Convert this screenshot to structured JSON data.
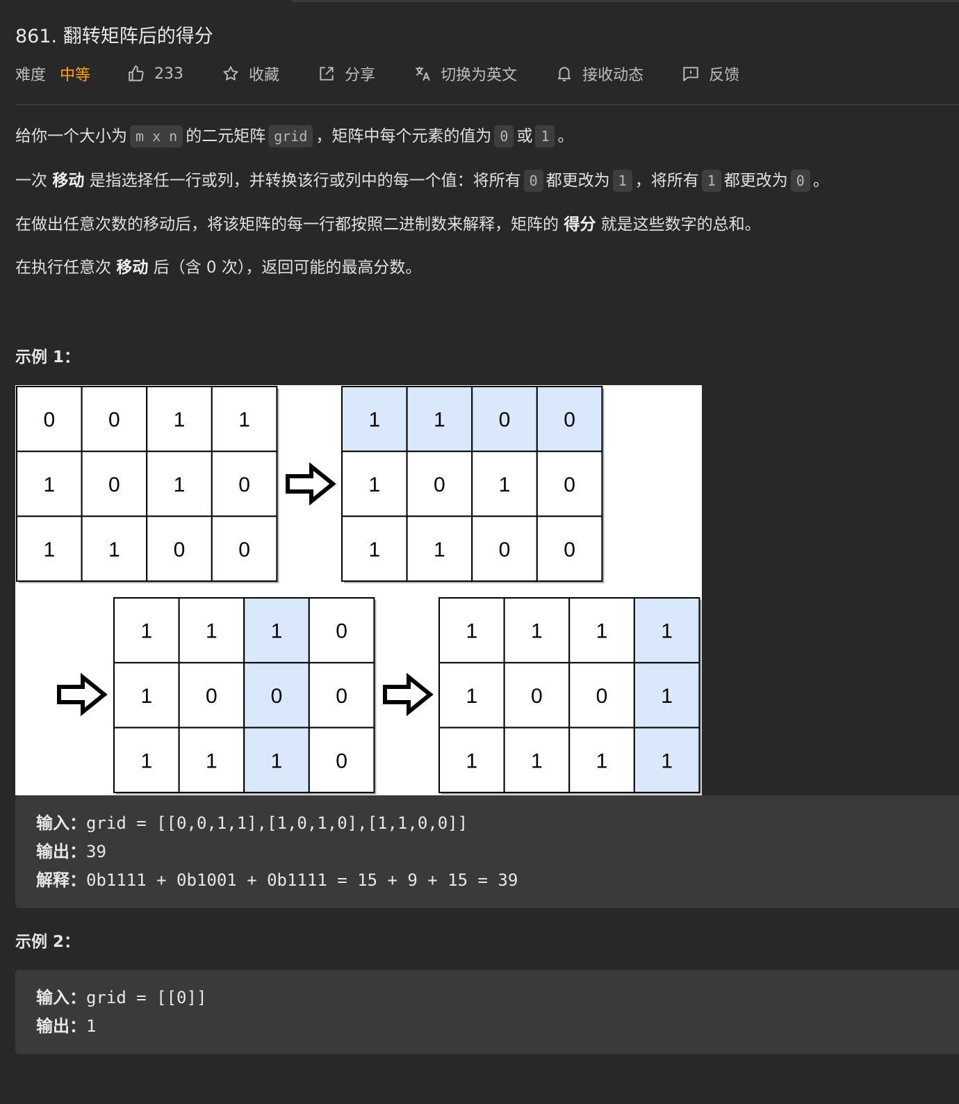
{
  "problem": {
    "title": "861. 翻转矩阵后的得分",
    "difficulty_label": "难度",
    "difficulty_value": "中等",
    "likes": "233",
    "favorite": "收藏",
    "share": "分享",
    "switch_lang": "切换为英文",
    "subscribe": "接收动态",
    "feedback": "反馈"
  },
  "description": {
    "p1": {
      "t1": "给你一个大小为",
      "c1": "m x n",
      "t2": "的二元矩阵",
      "c2": "grid",
      "t3": "，矩阵中每个元素的值为",
      "c3": "0",
      "t4": "或",
      "c4": "1",
      "t5": "。"
    },
    "p2": {
      "t1": "一次 ",
      "b1": "移动",
      "t2": " 是指选择任一行或列，并转换该行或列中的每一个值：将所有",
      "c1": "0",
      "t3": "都更改为",
      "c2": "1",
      "t4": "，将所有",
      "c3": "1",
      "t5": "都更改为",
      "c4": "0",
      "t6": "。"
    },
    "p3": {
      "t1": "在做出任意次数的移动后，将该矩阵的每一行都按照二进制数来解释，矩阵的 ",
      "b1": "得分",
      "t2": " 就是这些数字的总和。"
    },
    "p4": {
      "t1": "在执行任意次 ",
      "b1": "移动",
      "t2": " 后（含 0 次），返回可能的最高分数。"
    }
  },
  "examples": [
    {
      "title": "示例 1：",
      "input_label": "输入：",
      "input": "grid = [[0,0,1,1],[1,0,1,0],[1,1,0,0]]",
      "output_label": "输出：",
      "output": "39",
      "explain_label": "解释：",
      "explain": "0b1111 + 0b1001 + 0b1111 = 15 + 9 + 15 = 39"
    },
    {
      "title": "示例 2：",
      "input_label": "输入：",
      "input": "grid = [[0]]",
      "output_label": "输出：",
      "output": "1"
    }
  ],
  "figure": {
    "colors": {
      "highlight": "#dae8fc",
      "plain": "#ffffff",
      "border": "#000000"
    },
    "grids": [
      {
        "cells": [
          [
            "0",
            "0",
            "1",
            "1"
          ],
          [
            "1",
            "0",
            "1",
            "0"
          ],
          [
            "1",
            "1",
            "0",
            "0"
          ]
        ],
        "highlight_row": -1,
        "highlight_col": -1
      },
      {
        "cells": [
          [
            "1",
            "1",
            "0",
            "0"
          ],
          [
            "1",
            "0",
            "1",
            "0"
          ],
          [
            "1",
            "1",
            "0",
            "0"
          ]
        ],
        "highlight_row": 0,
        "highlight_col": -1
      },
      {
        "cells": [
          [
            "1",
            "1",
            "1",
            "0"
          ],
          [
            "1",
            "0",
            "0",
            "0"
          ],
          [
            "1",
            "1",
            "1",
            "0"
          ]
        ],
        "highlight_row": -1,
        "highlight_col": 2
      },
      {
        "cells": [
          [
            "1",
            "1",
            "1",
            "1"
          ],
          [
            "1",
            "0",
            "0",
            "1"
          ],
          [
            "1",
            "1",
            "1",
            "1"
          ]
        ],
        "highlight_row": -1,
        "highlight_col": 3
      }
    ]
  }
}
